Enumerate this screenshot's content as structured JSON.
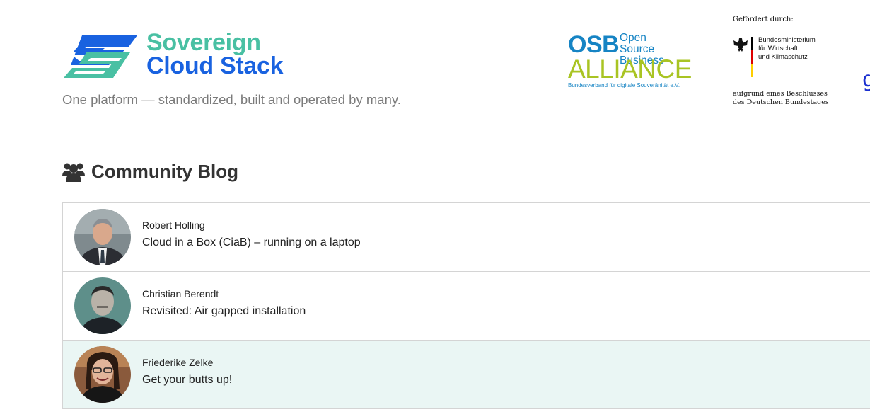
{
  "brand": {
    "name_line1": "Sovereign",
    "name_line2": "Cloud Stack",
    "tagline": "One platform — standardized, built and operated by many.",
    "colors": {
      "green": "#49c0a3",
      "blue": "#1962e0"
    },
    "icon": "sovereign-cloud-stack-logo"
  },
  "partners": {
    "osb": {
      "acronym": "OSB",
      "small": [
        "Open Source",
        "Business"
      ],
      "alliance": "ALLIANCE",
      "subtitle": "Bundesverband für digitale Souveränität e.V.",
      "colors": {
        "blue": "#1684c4",
        "green": "#a9c423"
      }
    },
    "funder": {
      "heading": "Gefördert durch:",
      "ministry_lines": [
        "Bundesministerium",
        "für Wirtschaft",
        "und Klimaschutz"
      ],
      "decision_lines": [
        "aufgrund eines Beschlusses",
        "des Deutschen Bundestages"
      ],
      "icon": "federal-eagle-icon"
    },
    "edge_glyph": "g"
  },
  "section": {
    "title": "Community Blog",
    "icon": "users-icon"
  },
  "posts": [
    {
      "author": "Robert Holling",
      "title": "Cloud in a Box (CiaB) – running on a laptop",
      "active": false
    },
    {
      "author": "Christian Berendt",
      "title": "Revisited: Air gapped installation",
      "active": false
    },
    {
      "author": "Friederike Zelke",
      "title": "Get your butts up!",
      "active": true
    }
  ],
  "colors": {
    "active_row": "#eaf6f4",
    "border": "#d4d4d4"
  }
}
